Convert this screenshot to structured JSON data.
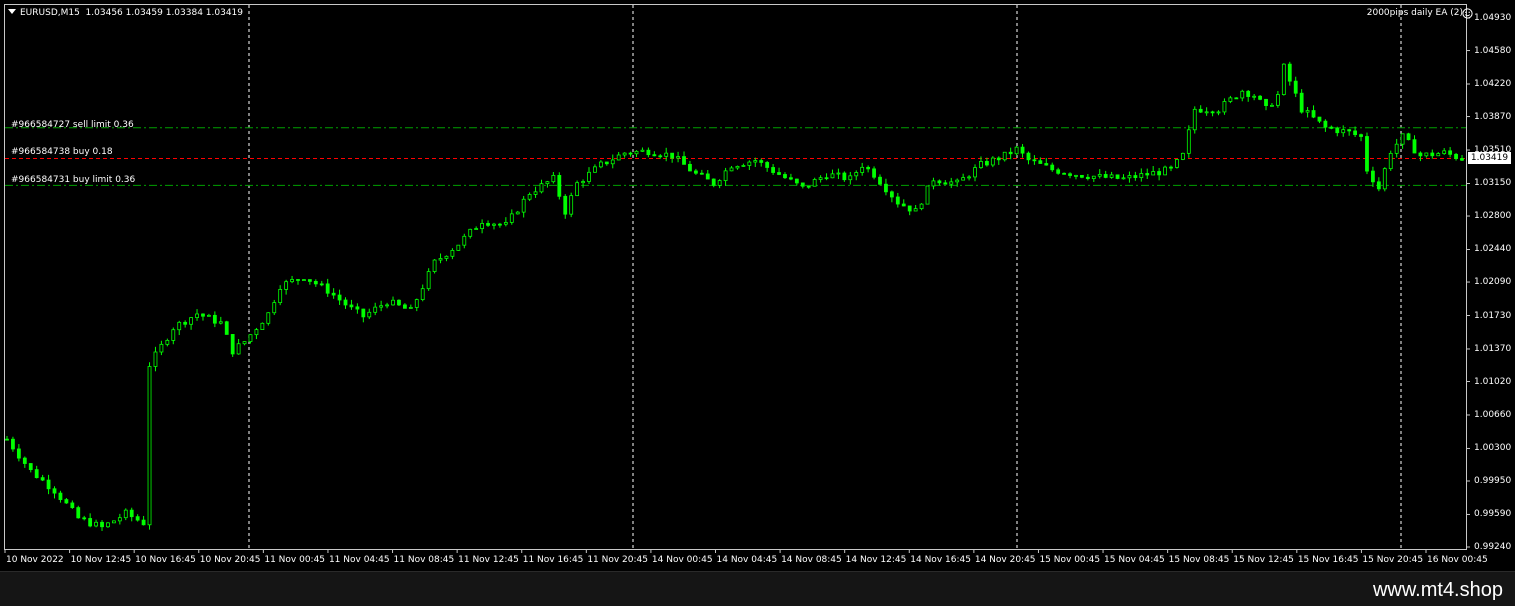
{
  "header": {
    "symbol_line": "EURUSD,M15  1.03456 1.03459 1.03384 1.03419",
    "ea_label": "2000pips daily EA (2)",
    "ea_icon": "smiley-icon"
  },
  "orders": [
    {
      "label": "#966584727 sell limit 0.36",
      "price": 1.0375,
      "kind": "sell limit"
    },
    {
      "label": "#966584738 buy 0.18",
      "price": 1.03419,
      "kind": "buy"
    },
    {
      "label": "#966584731 buy limit 0.36",
      "price": 1.0313,
      "kind": "buy limit"
    }
  ],
  "current_price": "1.03419",
  "watermark": "www.mt4.shop",
  "colors": {
    "background": "#000000",
    "candles": "#00ff00",
    "grid": "#ffffff",
    "order_line": "#00a000",
    "price_line": "#ff0000",
    "text": "#ffffff"
  },
  "chart_data": {
    "type": "candlestick",
    "ylim": [
      0.9924,
      1.0493
    ],
    "yticks": [
      "1.04930",
      "1.04580",
      "1.04220",
      "1.03870",
      "1.03510",
      "1.03150",
      "1.02800",
      "1.02440",
      "1.02090",
      "1.01730",
      "1.01370",
      "1.01020",
      "1.00660",
      "1.00300",
      "0.99950",
      "0.99590",
      "0.99240"
    ],
    "xticks": [
      "10 Nov 2022",
      "10 Nov 12:45",
      "10 Nov 16:45",
      "10 Nov 20:45",
      "11 Nov 00:45",
      "11 Nov 04:45",
      "11 Nov 08:45",
      "11 Nov 12:45",
      "11 Nov 16:45",
      "11 Nov 20:45",
      "14 Nov 00:45",
      "14 Nov 04:45",
      "14 Nov 08:45",
      "14 Nov 12:45",
      "14 Nov 16:45",
      "14 Nov 20:45",
      "15 Nov 00:45",
      "15 Nov 04:45",
      "15 Nov 08:45",
      "15 Nov 12:45",
      "15 Nov 16:45",
      "15 Nov 20:45",
      "16 Nov 00:45"
    ],
    "day_separators": [
      "11 Nov",
      "14 Nov",
      "15 Nov",
      "16 Nov"
    ],
    "close_path": [
      [
        0,
        1.004
      ],
      [
        4,
        1.0006
      ],
      [
        8,
        0.9985
      ],
      [
        12,
        0.9955
      ],
      [
        16,
        0.9945
      ],
      [
        20,
        0.996
      ],
      [
        23,
        0.995
      ],
      [
        24,
        1.012
      ],
      [
        28,
        1.016
      ],
      [
        32,
        1.0175
      ],
      [
        36,
        1.0165
      ],
      [
        38,
        1.0135
      ],
      [
        40,
        1.0145
      ],
      [
        44,
        1.0175
      ],
      [
        46,
        1.0205
      ],
      [
        50,
        1.0215
      ],
      [
        54,
        1.02
      ],
      [
        58,
        1.018
      ],
      [
        60,
        1.0172
      ],
      [
        64,
        1.0188
      ],
      [
        68,
        1.0178
      ],
      [
        72,
        1.023
      ],
      [
        76,
        1.025
      ],
      [
        80,
        1.0275
      ],
      [
        84,
        1.027
      ],
      [
        88,
        1.0305
      ],
      [
        92,
        1.032
      ],
      [
        94,
        1.0285
      ],
      [
        96,
        1.0315
      ],
      [
        100,
        1.0335
      ],
      [
        104,
        1.0348
      ],
      [
        108,
        1.035
      ],
      [
        112,
        1.0345
      ],
      [
        116,
        1.0325
      ],
      [
        119,
        1.0315
      ],
      [
        122,
        1.0335
      ],
      [
        126,
        1.034
      ],
      [
        130,
        1.0325
      ],
      [
        134,
        1.031
      ],
      [
        138,
        1.0325
      ],
      [
        142,
        1.032
      ],
      [
        144,
        1.0335
      ],
      [
        146,
        1.0325
      ],
      [
        150,
        1.0295
      ],
      [
        153,
        1.0285
      ],
      [
        156,
        1.032
      ],
      [
        160,
        1.0315
      ],
      [
        164,
        1.0335
      ],
      [
        168,
        1.0345
      ],
      [
        170,
        1.0352
      ],
      [
        172,
        1.034
      ],
      [
        176,
        1.033
      ],
      [
        180,
        1.0325
      ],
      [
        184,
        1.0322
      ],
      [
        188,
        1.032
      ],
      [
        192,
        1.0325
      ],
      [
        196,
        1.033
      ],
      [
        198,
        1.0345
      ],
      [
        200,
        1.0395
      ],
      [
        204,
        1.0395
      ],
      [
        208,
        1.0415
      ],
      [
        210,
        1.041
      ],
      [
        212,
        1.0395
      ],
      [
        214,
        1.041
      ],
      [
        215,
        1.044
      ],
      [
        218,
        1.0395
      ],
      [
        222,
        1.0375
      ],
      [
        226,
        1.037
      ],
      [
        228,
        1.0365
      ],
      [
        229,
        1.033
      ],
      [
        231,
        1.031
      ],
      [
        233,
        1.035
      ],
      [
        235,
        1.0365
      ],
      [
        238,
        1.0345
      ],
      [
        242,
        1.0348
      ],
      [
        245,
        1.0342
      ]
    ]
  }
}
